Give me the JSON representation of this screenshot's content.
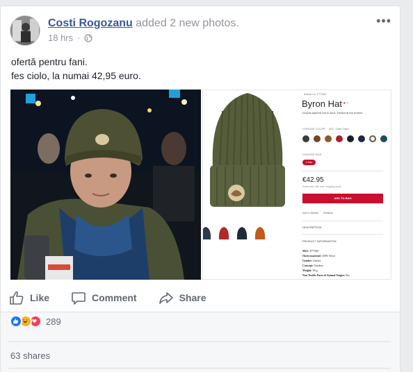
{
  "post": {
    "author": "Costi Rogozanu",
    "action": "added 2 new photos.",
    "time": "18 hrs",
    "dot": "·",
    "privacy_icon": "globe-icon",
    "more_icon": "more-options-icon",
    "text_lines": [
      "ofertă pentru fani.",
      "fes ciolo, la numai 42,95 euro."
    ]
  },
  "product_photo": {
    "article": "Article no. F77300",
    "title": "Byron Hat",
    "stars": "★☆",
    "description": "Double-layered hat in wool. Folded at the bottom.",
    "choose_color": "CHOOSE COLOR",
    "color_selected": "633 - Dark Olive",
    "colors": [
      "#3a3a36",
      "#6b4a2b",
      "#8a5a2b",
      "#b01e2a",
      "#1b1e2b",
      "#1e2a40",
      "#5b5e36",
      "#1f4f56"
    ],
    "choose_size": "CHOOSE SIZE",
    "size": "1 Size",
    "price": "€42.95",
    "vat_note": "Prices incl. VAT excl. shipping costs",
    "add_to_bag": "ADD TO BAG",
    "wishlist": "Add to Wishlist",
    "retailers": "Retailers",
    "description_header": "DESCRIPTION",
    "product_info_header": "PRODUCT INFORMATION",
    "info": [
      {
        "key": "SKU:",
        "value": "F77300"
      },
      {
        "key": "Outer material:",
        "value": "100% Wool"
      },
      {
        "key": "Gender:",
        "value": "Unisex"
      },
      {
        "key": "Concept:",
        "value": "Outdoor"
      },
      {
        "key": "Weight:",
        "value": "90 g"
      },
      {
        "key": "Non Textile Parts of Animal Origin:",
        "value": "Yes"
      }
    ],
    "thumb_colors": [
      "#2c3a4a",
      "#b02a2a",
      "#1f2a3a",
      "#c05a1e"
    ]
  },
  "actions": {
    "like": "Like",
    "comment": "Comment",
    "share": "Share"
  },
  "stats": {
    "reaction_count": "289",
    "shares": "63 shares"
  }
}
